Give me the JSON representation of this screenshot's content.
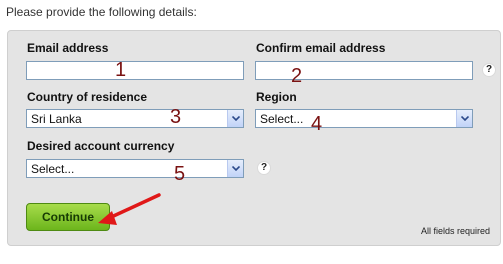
{
  "intro_text": "Please provide the following details:",
  "form": {
    "email_label": "Email address",
    "email_value": "",
    "confirm_email_label": "Confirm email address",
    "confirm_email_value": "",
    "country_label": "Country of residence",
    "country_value": "Sri Lanka",
    "region_label": "Region",
    "region_value": "Select...",
    "currency_label": "Desired account currency",
    "currency_value": "Select...",
    "help_glyph": "?",
    "continue_label": "Continue",
    "required_note": "All fields required"
  },
  "annotations": {
    "n1": "1",
    "n2": "2",
    "n3": "3",
    "n4": "4",
    "n5": "5",
    "color": "#7a1212",
    "arrow_color": "#e01818"
  }
}
